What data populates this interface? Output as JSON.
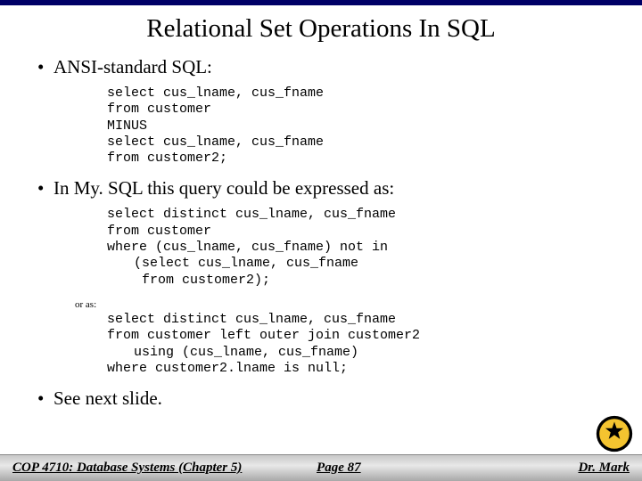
{
  "title": "Relational Set Operations In SQL",
  "bullets": {
    "ansi": "ANSI-standard SQL:",
    "mysql": "In My. SQL this query could be expressed as:",
    "see": "See next slide."
  },
  "code": {
    "ansi": {
      "l1": "select cus_lname, cus_fname",
      "l2": "from customer",
      "l3": "MINUS",
      "l4": "select cus_lname, cus_fname",
      "l5": "from customer2;"
    },
    "mysql1": {
      "l1": "select distinct cus_lname, cus_fname",
      "l2": "from customer",
      "l3": "where (cus_lname, cus_fname) not in",
      "l4": "(select cus_lname, cus_fname",
      "l5": " from customer2);"
    },
    "or_as": "or as:",
    "mysql2": {
      "l1": "select distinct cus_lname, cus_fname",
      "l2": "from customer left outer join customer2",
      "l3": "using (cus_lname, cus_fname)",
      "l4": "where customer2.lname is null;"
    }
  },
  "footer": {
    "course": "COP 4710: Database Systems  (Chapter 5)",
    "page": "Page 87",
    "author": "Dr. Mark"
  }
}
